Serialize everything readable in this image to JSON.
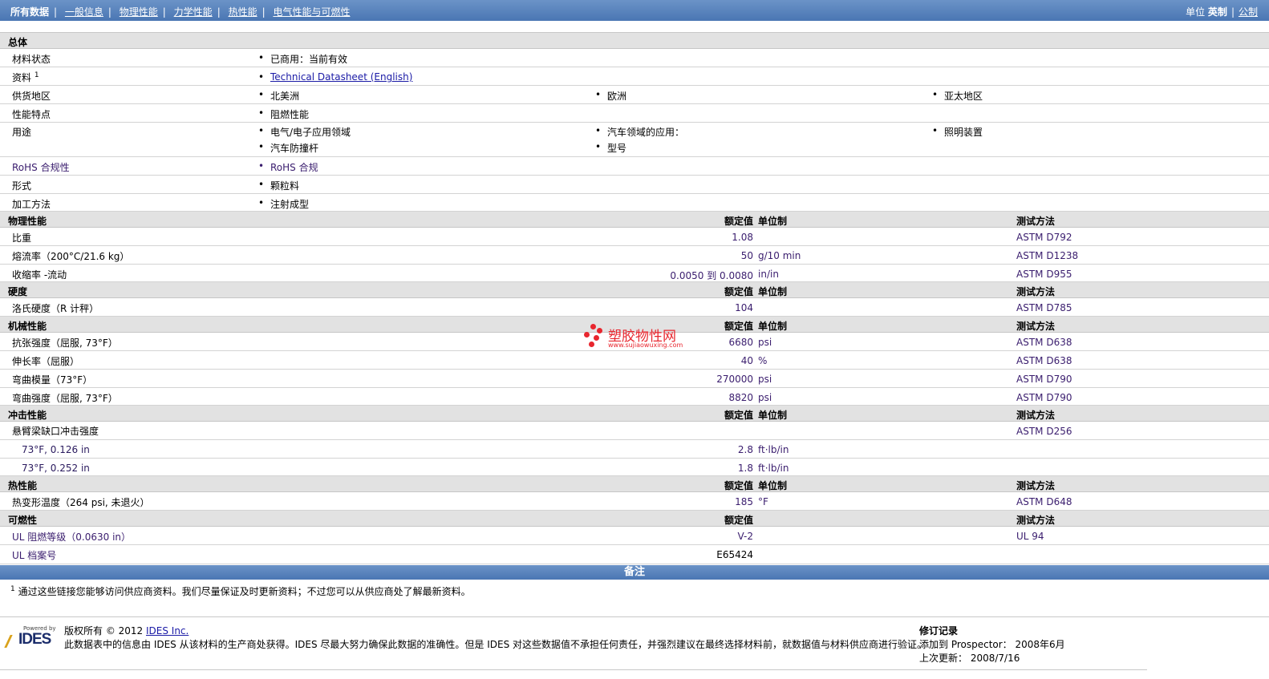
{
  "topnav": {
    "items": [
      "所有数据",
      "一般信息",
      "物理性能",
      "力学性能",
      "热性能",
      "电气性能与可燃性"
    ],
    "units_label": "单位",
    "units": [
      "英制",
      "公制"
    ]
  },
  "general": {
    "title": "总体",
    "material_status": {
      "label": "材料状态",
      "value": "已商用：当前有效"
    },
    "literature": {
      "label": "资料",
      "sup": "1",
      "link": "Technical Datasheet (English)"
    },
    "availability": {
      "label": "供货地区",
      "values": [
        "北美洲",
        "欧洲",
        "亚太地区"
      ]
    },
    "features": {
      "label": "性能特点",
      "value": "阻燃性能"
    },
    "uses": {
      "label": "用途",
      "values": [
        "电气/电子应用领域",
        "汽车领域的应用：",
        "照明装置",
        "汽车防撞杆",
        "型号"
      ]
    },
    "rohs": {
      "label": "RoHS 合规性",
      "value": "RoHS 合规"
    },
    "form": {
      "label": "形式",
      "value": "颗粒料"
    },
    "processing": {
      "label": "加工方法",
      "value": "注射成型"
    }
  },
  "headers": {
    "nominal": "额定值",
    "unit": "单位制",
    "test": "测试方法"
  },
  "physical": {
    "title": "物理性能",
    "rows": [
      {
        "label": "比重",
        "value": "1.08",
        "unit": "",
        "test": "ASTM D792"
      },
      {
        "label": "熔流率（200°C/21.6 kg）",
        "value": "50",
        "unit": "g/10 min",
        "test": "ASTM D1238"
      },
      {
        "label": "收缩率 -流动",
        "value": "0.0050 到 0.0080",
        "unit": "in/in",
        "test": "ASTM D955"
      }
    ]
  },
  "hardness": {
    "title": "硬度",
    "rows": [
      {
        "label": "洛氏硬度（R 计秤）",
        "value": "104",
        "unit": "",
        "test": "ASTM D785"
      }
    ]
  },
  "mechanical": {
    "title": "机械性能",
    "rows": [
      {
        "label": "抗张强度（屈服, 73°F）",
        "value": "6680",
        "unit": "psi",
        "test": "ASTM D638"
      },
      {
        "label": "伸长率（屈服）",
        "value": "40",
        "unit": "%",
        "test": "ASTM D638"
      },
      {
        "label": "弯曲模量（73°F）",
        "value": "270000",
        "unit": "psi",
        "test": "ASTM D790"
      },
      {
        "label": "弯曲强度（屈服, 73°F）",
        "value": "8820",
        "unit": "psi",
        "test": "ASTM D790"
      }
    ]
  },
  "impact": {
    "title": "冲击性能",
    "main": {
      "label": "悬臂梁缺口冲击强度",
      "test": "ASTM D256"
    },
    "rows": [
      {
        "label": "73°F, 0.126 in",
        "value": "2.8",
        "unit": "ft·lb/in"
      },
      {
        "label": "73°F, 0.252 in",
        "value": "1.8",
        "unit": "ft·lb/in"
      }
    ]
  },
  "thermal": {
    "title": "热性能",
    "rows": [
      {
        "label": "热变形温度（264 psi, 未退火）",
        "value": "185",
        "unit": "°F",
        "test": "ASTM D648"
      }
    ]
  },
  "flammability": {
    "title": "可燃性",
    "rows": [
      {
        "label": "UL 阻燃等级（0.0630 in）",
        "value": "V-2",
        "test": "UL 94"
      },
      {
        "label": "UL 档案号",
        "value": "E65424",
        "test": ""
      }
    ]
  },
  "notes": {
    "title": "备注",
    "sup": "1",
    "text": "通过这些链接您能够访问供应商资料。我们尽量保证及时更新资料；不过您可以从供应商处了解最新资料。"
  },
  "watermark": {
    "title": "塑胶物性网",
    "url": "www.sujiaowuxing.com"
  },
  "footer": {
    "logo_powered": "Powered by",
    "logo_text": "IDES",
    "copyright_prefix": "版权所有 © 2012 ",
    "copyright_link": "IDES Inc.",
    "disclaimer": "此数据表中的信息由 IDES 从该材料的生产商处获得。IDES 尽最大努力确保此数据的准确性。但是 IDES 对这些数据值不承担任何责任，并强烈建议在最终选择材料前，就数据值与材料供应商进行验证。",
    "revision_title": "修订记录",
    "added": "添加到 Prospector： 2008年6月",
    "updated": "上次更新： 2008/7/16"
  }
}
